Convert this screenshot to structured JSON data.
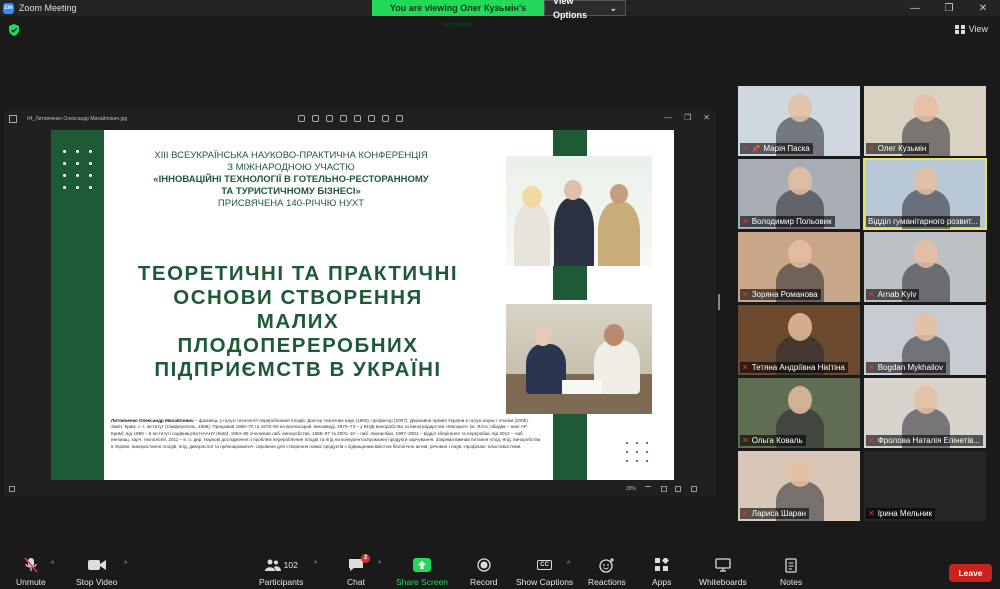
{
  "window": {
    "app_title": "Zoom Meeting",
    "logo_text": "zm",
    "minimize": "—",
    "maximize": "❐",
    "close": "✕"
  },
  "banner": {
    "viewing_text": "You are viewing Олег Кузьмін's screen",
    "view_options": "View Options",
    "chevron": "⌄"
  },
  "view_button": {
    "label": "View"
  },
  "shared_window": {
    "file_name": "04_Литовченко Олександр Михайлович.jpg",
    "zoom_percent": "28%",
    "slide": {
      "conf_line1": "XIII ВСЕУКРАЇНСЬКА НАУКОВО-ПРАКТИЧНА КОНФЕРЕНЦІЯ",
      "conf_line2": "З МІЖНАРОДНОЮ УЧАСТЮ",
      "conf_line3": "«ІННОВАЦІЙНІ ТЕХНОЛОГІЇ В ГОТЕЛЬНО-РЕСТОРАННОМУ",
      "conf_line4": "ТА ТУРИСТИЧНОМУ БІЗНЕСІ»",
      "conf_line5": "ПРИСВЯЧЕНА 140-РІЧЧЮ НУХТ",
      "title_line1": "ТЕОРЕТИЧНІ ТА ПРАКТИЧНІ",
      "title_line2": "ОСНОВИ СТВОРЕННЯ",
      "title_line3": "МАЛИХ",
      "title_line4": "ПЛОДОПЕРЕРОБНИХ",
      "title_line5": "ПІДПРИЄМСТВ В УКРАЇНІ",
      "bio_name": "Литовченко Олександр Михайлович",
      "bio_text": " – фахівець у галузі технології переробления плодів. Доктор технічних наук (1994), професор (2007). Державна премія України в галузі науки і техніки (2005). Закін. Крим. с.-г. інститут (Сімферополь, 1968). Працював 1968–70 та 1973–80 на Бахчисарай. винзаводі, 1970–73 – у ВНДІ виноробства та виноградарства «Магарач» (м. Ялта; обидва – нині АР Крим); від 1980 – в Інституті садівництва НААНУ (Київ): 1984–86 очолював лаб. виноробства, 1986–97 та 2001–10 – лаб. переробки, 1997–2001 – відділ зберігання та переробки, від 2012 – лаб. инновац. харч. технологій, 2011 – в. о. дир. Наукові дослідження з проблем переробления плодів та ягід на конкурентоспроможні продукти харчування. Зокрема вивчав питання плод.-ягід. виноробства в Україні, використання плодів, ягід, дикорослої та пряноароматич. сировини для створення нових продуктів з підвищеним вмістом біологічно актив. речовин і лікув.-профілакт. властивостями."
    }
  },
  "participants_tiles": [
    {
      "name": "Марія Паска",
      "muted": true,
      "pinned": true,
      "active": false,
      "bg": "#cfd7e0"
    },
    {
      "name": "Олег Кузьмін",
      "muted": true,
      "pinned": false,
      "active": false,
      "bg": "#d9d2c2"
    },
    {
      "name": "Володимир Польовик",
      "muted": true,
      "pinned": false,
      "active": false,
      "bg": "#a9aeb6"
    },
    {
      "name": "Відділ гуманітарного розвит...",
      "muted": false,
      "pinned": false,
      "active": true,
      "bg": "#b8c8d6"
    },
    {
      "name": "Зоряна Романова",
      "muted": true,
      "pinned": false,
      "active": false,
      "bg": "#c9a88a"
    },
    {
      "name": "Arnab Kyiv",
      "muted": true,
      "pinned": false,
      "active": false,
      "bg": "#bcc1c4"
    },
    {
      "name": "Тетяна Андріївна Нікітіна",
      "muted": true,
      "pinned": false,
      "active": false,
      "bg": "#6b4a30"
    },
    {
      "name": "Bogdan Mykhailov",
      "muted": true,
      "pinned": false,
      "active": false,
      "bg": "#c8ccd2"
    },
    {
      "name": "Ольга Коваль",
      "muted": true,
      "pinned": false,
      "active": false,
      "bg": "#5f6e52"
    },
    {
      "name": "Фролова Наталія Епінетів...",
      "muted": true,
      "pinned": false,
      "active": false,
      "bg": "#d7d3cc"
    },
    {
      "name": "Лариса Шаран",
      "muted": true,
      "pinned": false,
      "active": false,
      "bg": "#d8c7b8"
    },
    {
      "name": "Ірина Мельник",
      "muted": true,
      "pinned": false,
      "active": false,
      "bg": "#262626"
    }
  ],
  "toolbar": {
    "unmute": "Unmute",
    "stop_video": "Stop Video",
    "participants": "Participants",
    "participants_count": "102",
    "chat": "Chat",
    "chat_badge": "2",
    "share_screen": "Share Screen",
    "record": "Record",
    "show_captions": "Show Captions",
    "captions_icon": "CC",
    "reactions": "Reactions",
    "apps": "Apps",
    "whiteboards": "Whiteboards",
    "notes": "Notes",
    "leave": "Leave",
    "caret": "^"
  },
  "colors": {
    "accent_green": "#23d959",
    "slide_green": "#1f5a37",
    "leave_red": "#c8241d",
    "active_speaker": "#e8e26b"
  }
}
